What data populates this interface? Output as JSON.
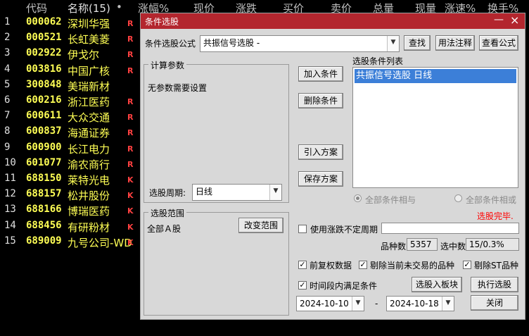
{
  "header": {
    "code": "代码",
    "name": "名称(15)",
    "dot": "•",
    "change_pct": "涨幅%",
    "price": "现价",
    "change": "涨跌",
    "bid": "买价",
    "ask": "卖价",
    "volume": "总量",
    "cur_vol": "现量",
    "speed": "涨速%",
    "turnover": "换手%"
  },
  "stocks": [
    {
      "idx": "1",
      "code": "000062",
      "name": "深圳华强",
      "flag": "R",
      "flag_color": "#ff4040"
    },
    {
      "idx": "2",
      "code": "000521",
      "name": "长虹美菱",
      "flag": "R",
      "flag_color": "#ff4040"
    },
    {
      "idx": "3",
      "code": "002922",
      "name": "伊戈尔",
      "flag": "R",
      "flag_color": "#ff4040"
    },
    {
      "idx": "4",
      "code": "003816",
      "name": "中国广核",
      "flag": "R",
      "flag_color": "#ff4040"
    },
    {
      "idx": "5",
      "code": "300848",
      "name": "美瑞新材",
      "flag": "",
      "flag_color": "#ff4040"
    },
    {
      "idx": "6",
      "code": "600216",
      "name": "浙江医药",
      "flag": "R",
      "flag_color": "#ff4040"
    },
    {
      "idx": "7",
      "code": "600611",
      "name": "大众交通",
      "flag": "R",
      "flag_color": "#ff4040"
    },
    {
      "idx": "8",
      "code": "600837",
      "name": "海通证券",
      "flag": "R",
      "flag_color": "#ff4040"
    },
    {
      "idx": "9",
      "code": "600900",
      "name": "长江电力",
      "flag": "R",
      "flag_color": "#ff4040"
    },
    {
      "idx": "10",
      "code": "601077",
      "name": "渝农商行",
      "flag": "R",
      "flag_color": "#ff4040"
    },
    {
      "idx": "11",
      "code": "688150",
      "name": "莱特光电",
      "flag": "K",
      "flag_color": "#ff4040"
    },
    {
      "idx": "12",
      "code": "688157",
      "name": "松井股份",
      "flag": "K",
      "flag_color": "#ff4040"
    },
    {
      "idx": "13",
      "code": "688166",
      "name": "博瑞医药",
      "flag": "K",
      "flag_color": "#ff4040"
    },
    {
      "idx": "14",
      "code": "688456",
      "name": "有研粉材",
      "flag": "K",
      "flag_color": "#ff4040"
    },
    {
      "idx": "15",
      "code": "689009",
      "name": "九号公司-WD",
      "flag": "K",
      "flag_color": "#ff4040"
    }
  ],
  "dialog": {
    "title": "条件选股",
    "formula_label": "条件选股公式",
    "formula_value": "共振信号选股 -",
    "find_btn": "查找",
    "usage_btn": "用法注释",
    "view_btn": "查看公式",
    "params_group": "计算参数",
    "no_params": "无参数需要设置",
    "period_label": "选股周期:",
    "period_value": "日线",
    "add_btn": "加入条件",
    "del_btn": "删除条件",
    "import_btn": "引入方案",
    "save_btn": "保存方案",
    "list_label": "选股条件列表",
    "list_item": "共振信号选股  日线",
    "radio_and": "全部条件相与",
    "radio_or": "全部条件相或",
    "status": "选股完毕.",
    "status_color": "#ff0000",
    "range_group": "选股范围",
    "range_value": "全部Ａ股",
    "change_range_btn": "改变范围",
    "use_period": "使用涨跌不定周期",
    "count_label": "品种数",
    "count_value": "5357",
    "selected_label": "选中数",
    "selected_value": "15/0.3%",
    "fq_label": "前复权数据",
    "exclude_label": "剔除当前未交易的品种",
    "exclude_st": "剔除ST品种",
    "time_label": "时间段内满足条件",
    "to_block_btn": "选股入板块",
    "execute_btn": "执行选股",
    "date_from": "2024-10-10",
    "dash": "-",
    "date_to": "2024-10-18",
    "close_btn": "关闭"
  }
}
